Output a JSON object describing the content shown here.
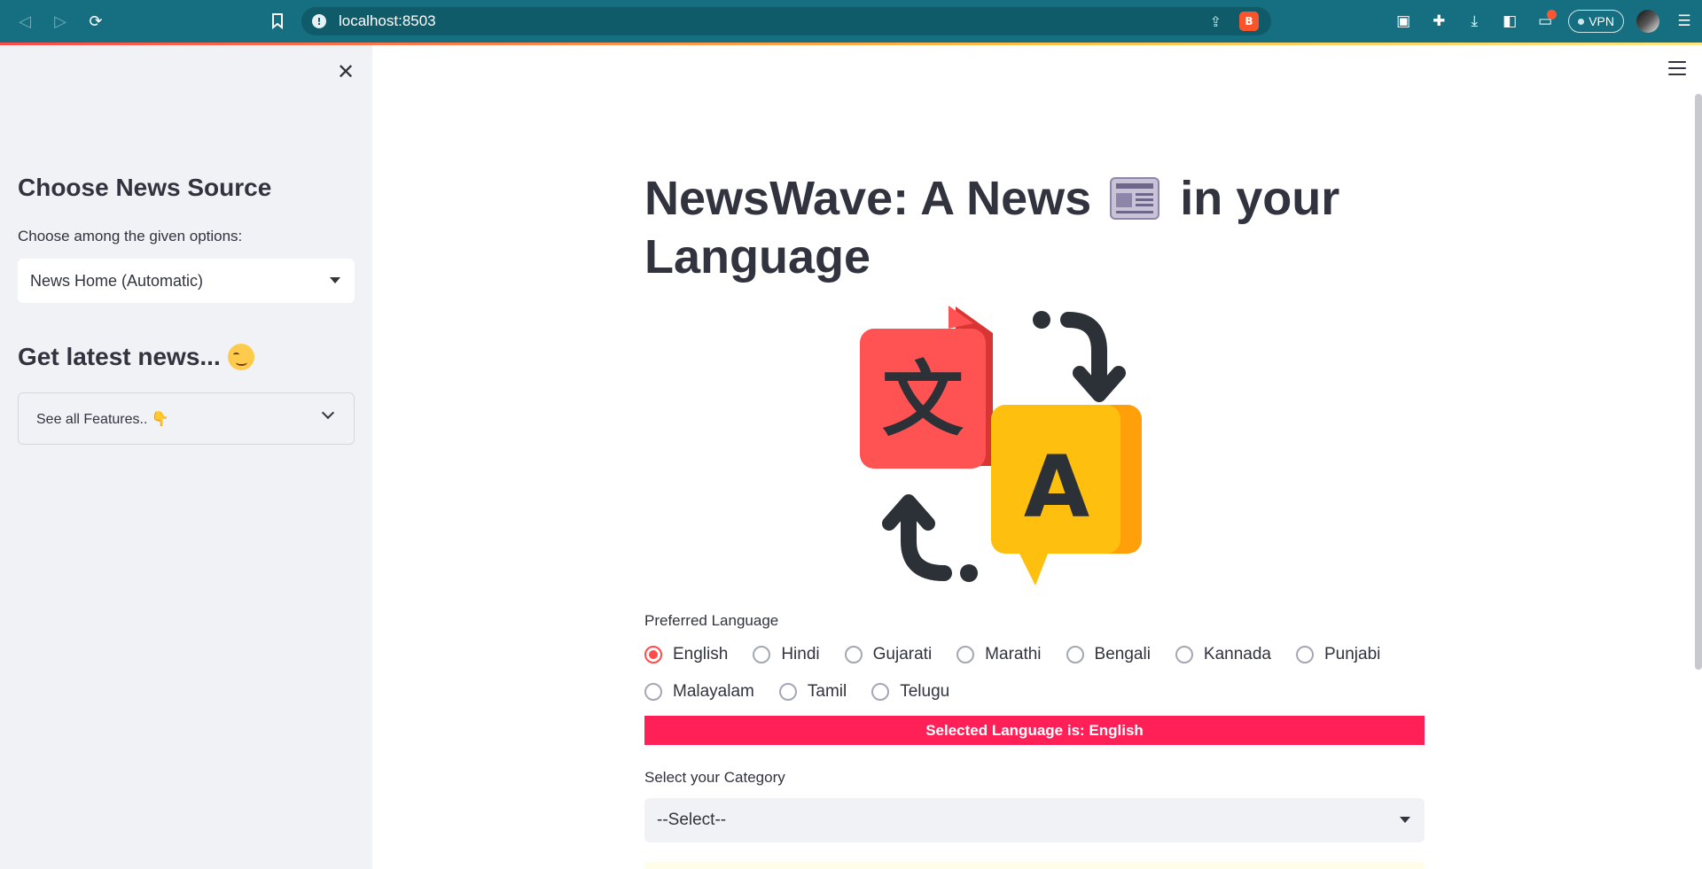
{
  "browser": {
    "url": "localhost:8503",
    "vpn_label": "VPN",
    "accent": "#156f80"
  },
  "sidebar": {
    "source_heading": "Choose News Source",
    "source_label": "Choose among the given options:",
    "source_selected": "News Home (Automatic)",
    "latest_heading": "Get latest news...",
    "features_expander": "See all Features.. 👇",
    "background": "#f0f2f6"
  },
  "main": {
    "title_part1": "NewsWave: A News",
    "title_part2": "in your Language",
    "preferred_language_label": "Preferred Language",
    "languages": [
      "English",
      "Hindi",
      "Gujarati",
      "Marathi",
      "Bengali",
      "Kannada",
      "Punjabi",
      "Malayalam",
      "Tamil",
      "Telugu"
    ],
    "selected_language": "English",
    "selected_banner": "Selected Language is: English",
    "category_label": "Select your Category",
    "category_selected": "--Select--",
    "primary_color": "#ff4b4b",
    "banner_color": "#ff2057"
  }
}
